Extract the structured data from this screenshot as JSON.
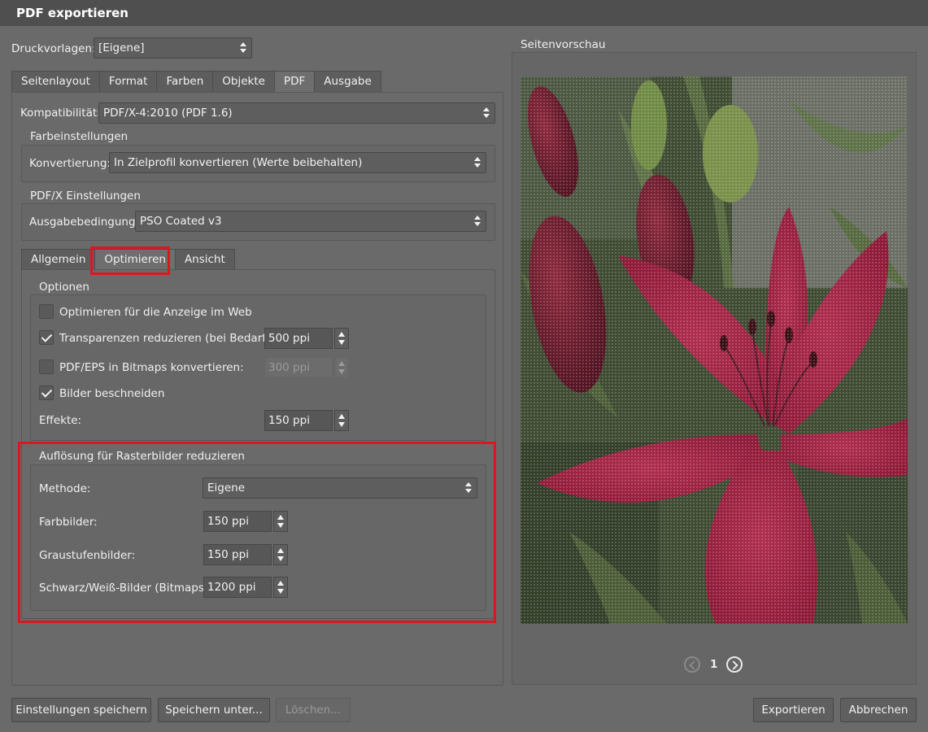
{
  "window": {
    "title": "PDF exportieren"
  },
  "presets": {
    "label": "Druckvorlagen:",
    "value": "[Eigene]"
  },
  "main_tabs": [
    "Seitenlayout",
    "Format",
    "Farben",
    "Objekte",
    "PDF",
    "Ausgabe"
  ],
  "main_tab_active": "PDF",
  "compat": {
    "label": "Kompatibilität:",
    "value": "PDF/X-4:2010 (PDF 1.6)"
  },
  "farbeinstellungen": {
    "title": "Farbeinstellungen",
    "label": "Konvertierung:",
    "value": "In Zielprofil konvertieren (Werte beibehalten)"
  },
  "pdfx": {
    "title": "PDF/X Einstellungen",
    "label": "Ausgabebedingung:",
    "value": "PSO Coated v3"
  },
  "sub_tabs": [
    "Allgemein",
    "Optimieren",
    "Ansicht"
  ],
  "sub_tab_active": "Optimieren",
  "optionen": {
    "title": "Optionen",
    "web_label": "Optimieren für die Anzeige im Web",
    "web_checked": false,
    "transp_label": "Transparenzen reduzieren (bei Bedarf):",
    "transp_checked": true,
    "transp_value": "500 ppi",
    "bitmap_label": "PDF/EPS in Bitmaps konvertieren:",
    "bitmap_checked": false,
    "bitmap_value": "300 ppi",
    "crop_label": "Bilder beschneiden",
    "crop_checked": true,
    "effekte_label": "Effekte:",
    "effekte_value": "150 ppi"
  },
  "raster": {
    "title": "Auflösung für Rasterbilder reduzieren",
    "methode_label": "Methode:",
    "methode_value": "Eigene",
    "farb_label": "Farbbilder:",
    "farb_value": "150 ppi",
    "grau_label": "Graustufenbilder:",
    "grau_value": "150 ppi",
    "sw_label": "Schwarz/Weiß-Bilder (Bitmaps):",
    "sw_value": "1200 ppi"
  },
  "preview": {
    "title": "Seitenvorschau",
    "page": "1"
  },
  "buttons": {
    "save_settings": "Einstellungen speichern",
    "save_as": "Speichern unter...",
    "delete": "Löschen...",
    "export": "Exportieren",
    "cancel": "Abbrechen"
  },
  "colors": {
    "highlight": "#e0141e",
    "background": "#6a6a6a",
    "title_bar": "#4f4f4f"
  }
}
